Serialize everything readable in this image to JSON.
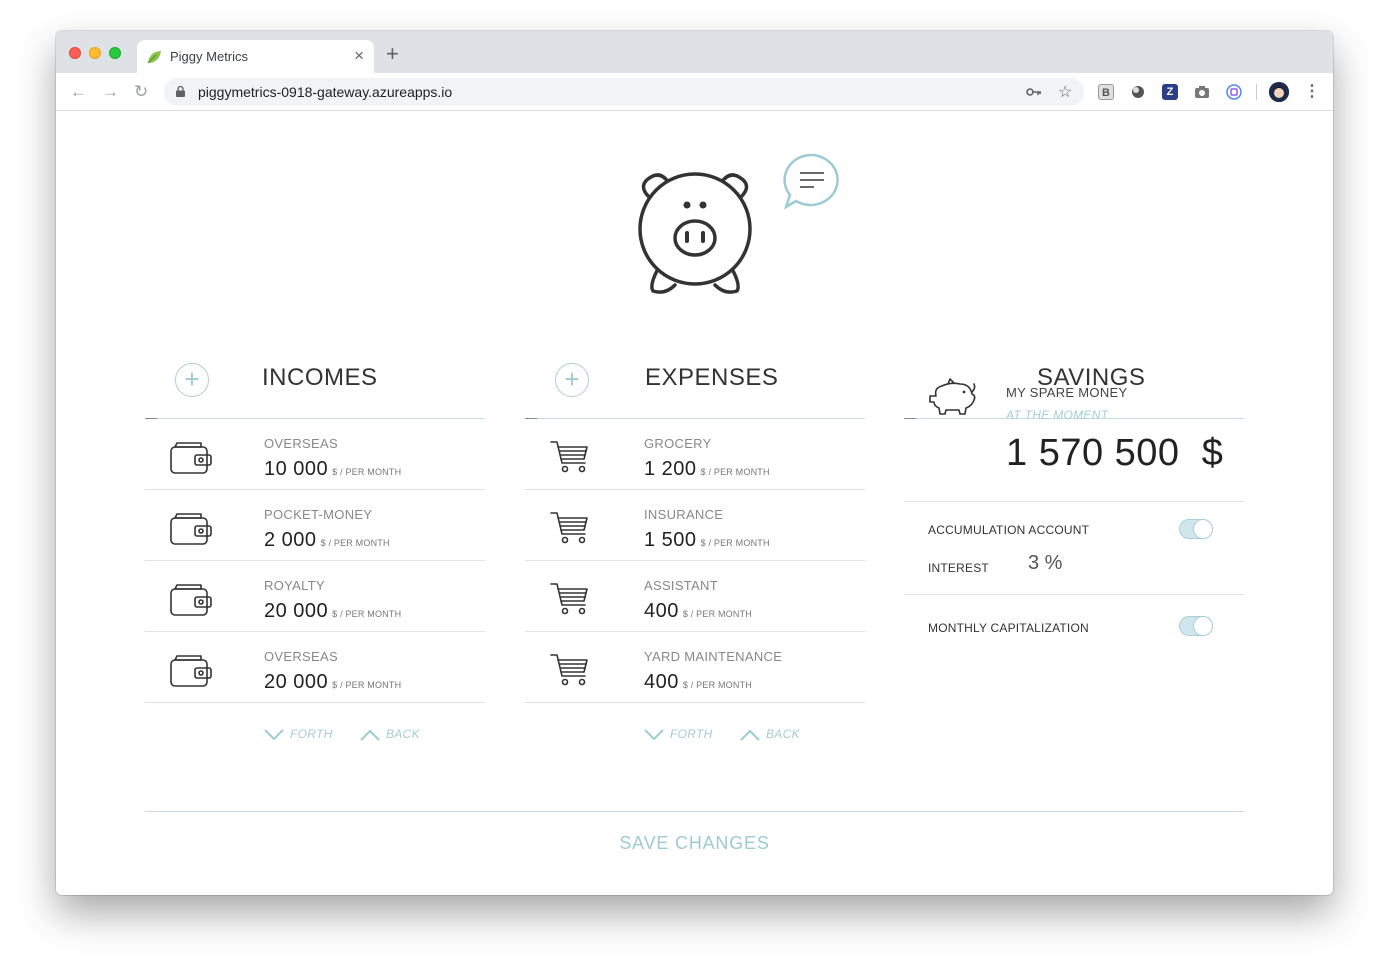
{
  "browser": {
    "tab_title": "Piggy Metrics",
    "url": "piggymetrics-0918-gateway.azureapps.io"
  },
  "incomes": {
    "title": "INCOMES",
    "items": [
      {
        "name": "OVERSEAS",
        "amount": "10 000",
        "period": "$ / PER MONTH"
      },
      {
        "name": "POCKET-MONEY",
        "amount": "2 000",
        "period": "$ / PER MONTH"
      },
      {
        "name": "ROYALTY",
        "amount": "20 000",
        "period": "$ / PER MONTH"
      },
      {
        "name": "OVERSEAS",
        "amount": "20 000",
        "period": "$ / PER MONTH"
      }
    ],
    "forth_label": "FORTH",
    "back_label": "BACK"
  },
  "expenses": {
    "title": "EXPENSES",
    "items": [
      {
        "name": "GROCERY",
        "amount": "1 200",
        "period": "$ / PER MONTH"
      },
      {
        "name": "INSURANCE",
        "amount": "1 500",
        "period": "$ / PER MONTH"
      },
      {
        "name": "ASSISTANT",
        "amount": "400",
        "period": "$ / PER MONTH"
      },
      {
        "name": "YARD MAINTENANCE",
        "amount": "400",
        "period": "$ / PER MONTH"
      }
    ],
    "forth_label": "FORTH",
    "back_label": "BACK"
  },
  "savings": {
    "title": "SAVINGS",
    "label": "MY SPARE MONEY",
    "sublabel": "AT THE MOMENT",
    "total": "1 570 500",
    "currency": "$",
    "accumulation_label": "ACCUMULATION ACCOUNT",
    "accumulation_on": true,
    "interest_label": "INTEREST",
    "interest_value": "3 %",
    "capitalization_label": "MONTHLY CAPITALIZATION",
    "capitalization_on": true
  },
  "save_label": "SAVE CHANGES",
  "icons": {
    "back": "arrow-left-icon",
    "forward": "arrow-right-icon",
    "reload": "reload-icon",
    "lock": "lock-icon",
    "key": "key-icon",
    "star": "star-icon",
    "menu": "kebab-menu-icon",
    "wallet": "wallet-icon",
    "cart": "cart-icon",
    "piggy": "piggy-bank-icon",
    "chat": "chat-bubble-icon"
  },
  "colors": {
    "accent": "#9ccad5",
    "text": "#222222",
    "muted": "#888888"
  }
}
